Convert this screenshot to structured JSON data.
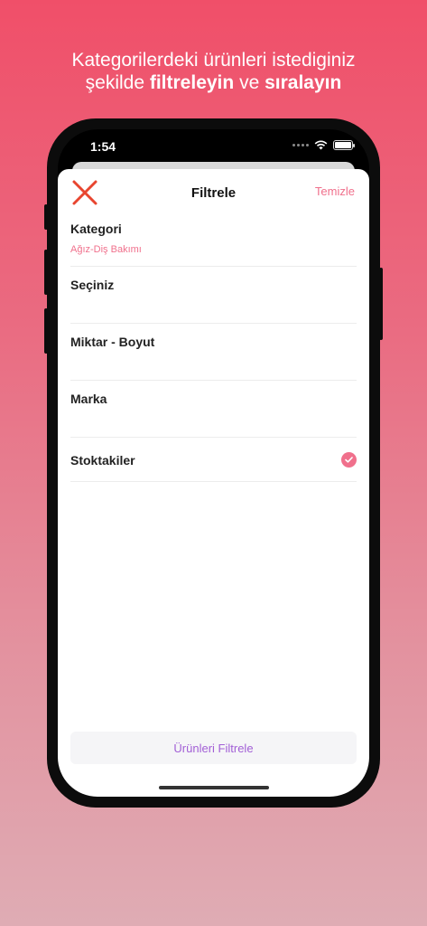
{
  "headline": {
    "line1": "Kategorilerdeki ürünleri istediginiz",
    "line2_prefix": "şekilde ",
    "line2_bold1": "filtreleyin",
    "line2_mid": " ve ",
    "line2_bold2": "sıralayın"
  },
  "status_bar": {
    "time": "1:54"
  },
  "nav": {
    "title": "Filtrele",
    "clear_label": "Temizle",
    "close_icon": "close-x-icon"
  },
  "filters": {
    "category": {
      "label": "Kategori",
      "value": "Ağız-Diş Bakımı"
    },
    "select": {
      "label": "Seçiniz"
    },
    "size": {
      "label": "Miktar - Boyut"
    },
    "brand": {
      "label": "Marka"
    },
    "in_stock": {
      "label": "Stoktakiler",
      "checked": true
    }
  },
  "footer": {
    "filter_button": "Ürünleri Filtrele"
  },
  "colors": {
    "accent": "#f0708c",
    "close": "#e8452f",
    "button_text": "#a25fd6"
  }
}
